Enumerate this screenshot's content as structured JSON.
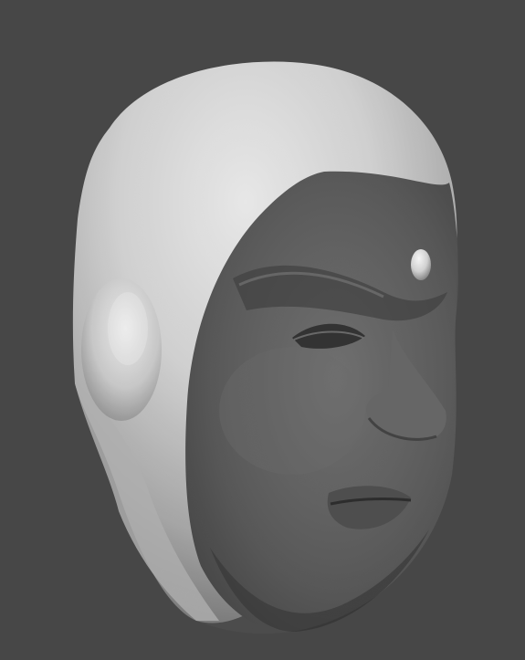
{
  "scene": {
    "subject": "sculpted-head-model",
    "colors": {
      "background": "#474747",
      "helmet_light": "#eaeaea",
      "helmet_mid": "#bdbdbd",
      "helmet_shadow": "#7a7a7a",
      "face_light": "#6f6f6f",
      "face_mid": "#565656",
      "face_shadow": "#2f2f2f",
      "earpiece_light": "#f2f2f2",
      "earpiece_shadow": "#8c8c8c",
      "gem_light": "#ffffff",
      "gem_shadow": "#a0a0a0"
    }
  }
}
